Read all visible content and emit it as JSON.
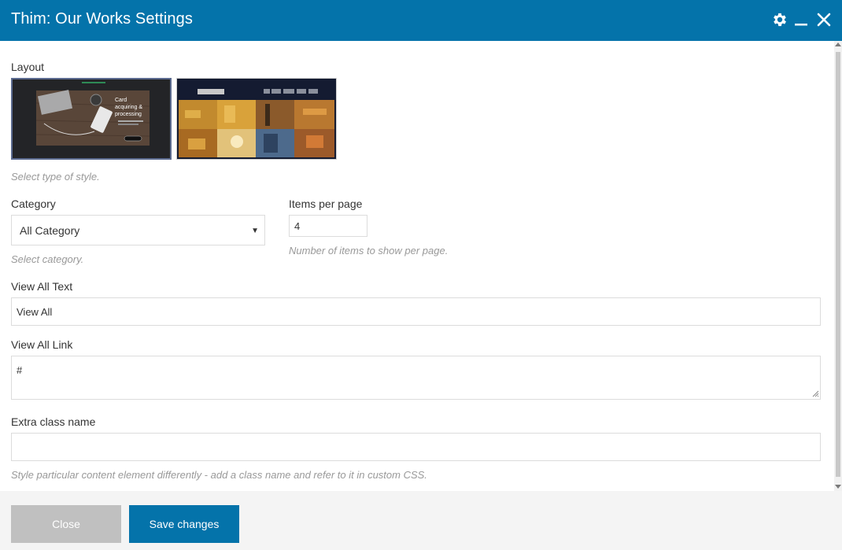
{
  "window": {
    "title": "Thim: Our Works Settings"
  },
  "icons": {
    "settings": "gear-icon",
    "minimize": "minimize-icon",
    "close": "close-icon"
  },
  "form": {
    "layout": {
      "label": "Layout",
      "help": "Select type of style.",
      "options": [
        {
          "name": "style-1",
          "selected": true,
          "preview_text": "Card acquiring & processing"
        },
        {
          "name": "style-2",
          "selected": false
        }
      ]
    },
    "category": {
      "label": "Category",
      "value": "All Category",
      "help": "Select category."
    },
    "items_per_page": {
      "label": "Items per page",
      "value": "4",
      "help": "Number of items to show per page."
    },
    "view_all_text": {
      "label": "View All Text",
      "value": "View All"
    },
    "view_all_link": {
      "label": "View All Link",
      "value": "#"
    },
    "extra_class": {
      "label": "Extra class name",
      "value": "",
      "help": "Style particular content element differently - add a class name and refer to it in custom CSS."
    }
  },
  "footer": {
    "close_label": "Close",
    "save_label": "Save changes"
  },
  "colors": {
    "header": "#0473aa",
    "primary_button": "#0473aa",
    "secondary_button": "#c0c0c0",
    "help_text": "#999999"
  }
}
